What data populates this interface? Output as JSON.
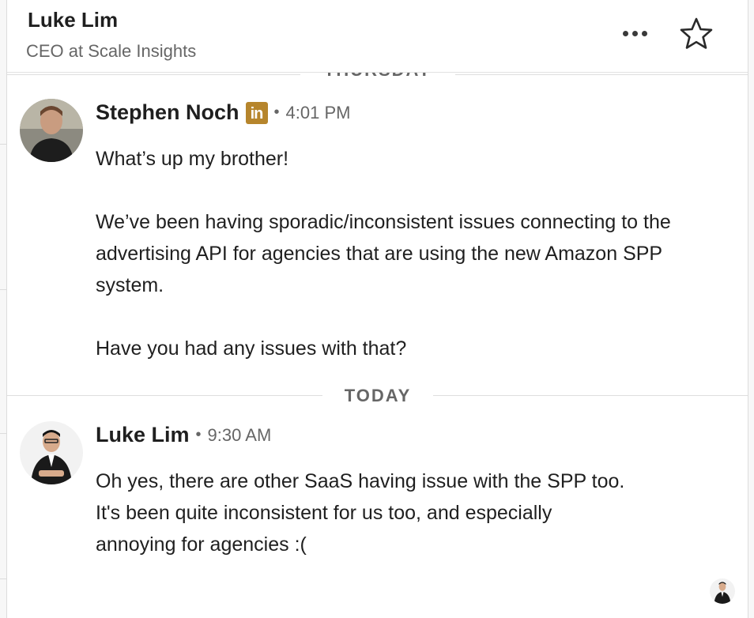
{
  "header": {
    "name": "Luke Lim",
    "subtitle": "CEO at Scale Insights",
    "more_icon": "more-horizontal-icon",
    "star_icon": "star-outline-icon"
  },
  "dividers": {
    "thursday": "THURSDAY",
    "today": "TODAY"
  },
  "messages": [
    {
      "sender": "Stephen Noch",
      "badge": "in",
      "badge_color": "#b6852c",
      "separator": "•",
      "time": "4:01 PM",
      "paragraphs": [
        "What’s up my brother!",
        "We’ve been having sporadic/inconsistent issues connecting to the advertising API for agencies that are using the new Amazon SPP system.",
        "Have you had any issues with that?"
      ]
    },
    {
      "sender": "Luke Lim",
      "separator": "•",
      "time": "9:30 AM",
      "paragraphs": [
        "Oh yes, there are other SaaS having issue with the SPP too. It's been quite inconsistent for us too, and especially annoying for agencies :("
      ]
    }
  ]
}
